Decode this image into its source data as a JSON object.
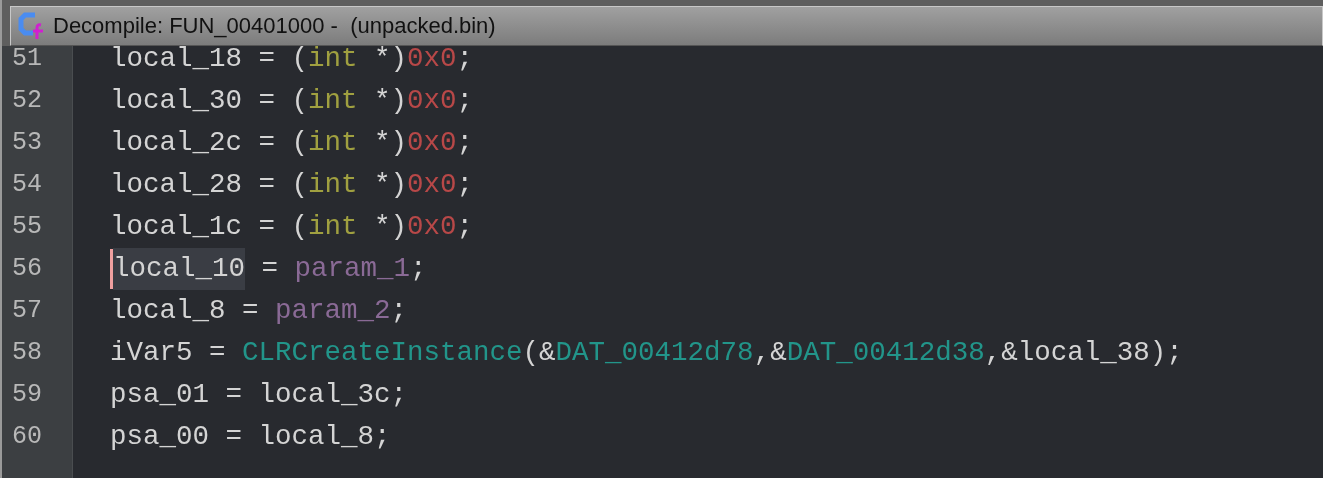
{
  "window": {
    "title": "Decompile: FUN_00401000 -  (unpacked.bin)"
  },
  "code": {
    "lines": [
      {
        "number": "51",
        "tokens": [
          {
            "kind": "var",
            "text": "local_18"
          },
          {
            "kind": "plain",
            "text": " = ("
          },
          {
            "kind": "type",
            "text": "int"
          },
          {
            "kind": "plain",
            "text": " *)"
          },
          {
            "kind": "const",
            "text": "0x0"
          },
          {
            "kind": "plain",
            "text": ";"
          }
        ]
      },
      {
        "number": "52",
        "tokens": [
          {
            "kind": "var",
            "text": "local_30"
          },
          {
            "kind": "plain",
            "text": " = ("
          },
          {
            "kind": "type",
            "text": "int"
          },
          {
            "kind": "plain",
            "text": " *)"
          },
          {
            "kind": "const",
            "text": "0x0"
          },
          {
            "kind": "plain",
            "text": ";"
          }
        ]
      },
      {
        "number": "53",
        "tokens": [
          {
            "kind": "var",
            "text": "local_2c"
          },
          {
            "kind": "plain",
            "text": " = ("
          },
          {
            "kind": "type",
            "text": "int"
          },
          {
            "kind": "plain",
            "text": " *)"
          },
          {
            "kind": "const",
            "text": "0x0"
          },
          {
            "kind": "plain",
            "text": ";"
          }
        ]
      },
      {
        "number": "54",
        "tokens": [
          {
            "kind": "var",
            "text": "local_28"
          },
          {
            "kind": "plain",
            "text": " = ("
          },
          {
            "kind": "type",
            "text": "int"
          },
          {
            "kind": "plain",
            "text": " *)"
          },
          {
            "kind": "const",
            "text": "0x0"
          },
          {
            "kind": "plain",
            "text": ";"
          }
        ]
      },
      {
        "number": "55",
        "tokens": [
          {
            "kind": "var",
            "text": "local_1c"
          },
          {
            "kind": "plain",
            "text": " = ("
          },
          {
            "kind": "type",
            "text": "int"
          },
          {
            "kind": "plain",
            "text": " *)"
          },
          {
            "kind": "const",
            "text": "0x0"
          },
          {
            "kind": "plain",
            "text": ";"
          }
        ]
      },
      {
        "number": "56",
        "cursor": true,
        "tokens": [
          {
            "kind": "var",
            "text": "local_10",
            "highlighted": true
          },
          {
            "kind": "plain",
            "text": " = "
          },
          {
            "kind": "param",
            "text": "param_1"
          },
          {
            "kind": "plain",
            "text": ";"
          }
        ]
      },
      {
        "number": "57",
        "tokens": [
          {
            "kind": "var",
            "text": "local_8"
          },
          {
            "kind": "plain",
            "text": " = "
          },
          {
            "kind": "param",
            "text": "param_2"
          },
          {
            "kind": "plain",
            "text": ";"
          }
        ]
      },
      {
        "number": "58",
        "tokens": [
          {
            "kind": "var",
            "text": "iVar5"
          },
          {
            "kind": "plain",
            "text": " = "
          },
          {
            "kind": "func",
            "text": "CLRCreateInstance"
          },
          {
            "kind": "plain",
            "text": "(&"
          },
          {
            "kind": "global",
            "text": "DAT_00412d78"
          },
          {
            "kind": "plain",
            "text": ",&"
          },
          {
            "kind": "global",
            "text": "DAT_00412d38"
          },
          {
            "kind": "plain",
            "text": ",&"
          },
          {
            "kind": "var",
            "text": "local_38"
          },
          {
            "kind": "plain",
            "text": ");"
          }
        ]
      },
      {
        "number": "59",
        "tokens": [
          {
            "kind": "var",
            "text": "psa_01"
          },
          {
            "kind": "plain",
            "text": " = "
          },
          {
            "kind": "var",
            "text": "local_3c"
          },
          {
            "kind": "plain",
            "text": ";"
          }
        ]
      },
      {
        "number": "60",
        "tokens": [
          {
            "kind": "var",
            "text": "psa_00"
          },
          {
            "kind": "plain",
            "text": " = "
          },
          {
            "kind": "var",
            "text": "local_8"
          },
          {
            "kind": "plain",
            "text": ";"
          }
        ]
      }
    ]
  }
}
